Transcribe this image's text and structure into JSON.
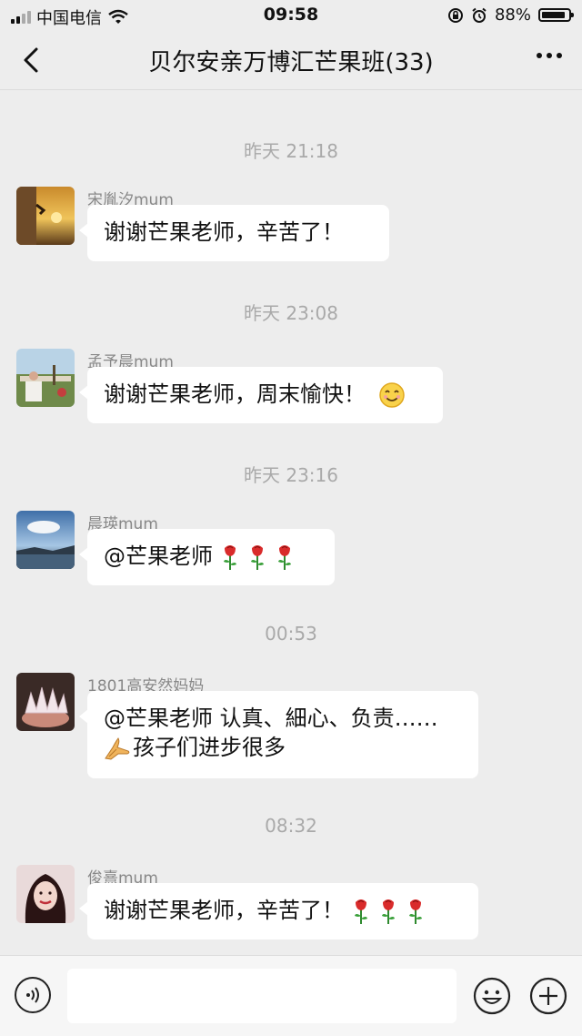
{
  "status_bar": {
    "carrier": "中国电信",
    "time": "09:58",
    "battery": "88%",
    "battery_level": 0.88
  },
  "header": {
    "back_icon": "chevron-left-icon",
    "title": "贝尔安亲万博汇芒果班(33)",
    "more_icon": "more-dots-icon"
  },
  "messages": [
    {
      "timestamp": "昨天 21:18",
      "sender": "宋胤汐mum",
      "text": "谢谢芒果老师，辛苦了！"
    },
    {
      "timestamp": "昨天 23:08",
      "sender": "孟予晨mum",
      "text": "谢谢芒果老师，周末愉快！",
      "emoji": "smile-emoji"
    },
    {
      "timestamp": "昨天 23:16",
      "sender": "晨瑛mum",
      "text": "@芒果老师",
      "emoji": "rose-emoji"
    },
    {
      "timestamp": "00:53",
      "sender": "1801高安然妈妈",
      "text_line1": "@芒果老师 认真、細心、负责……",
      "text_line2": "孩子们进步很多",
      "emoji": "praying-hands-emoji"
    },
    {
      "timestamp": "08:32",
      "sender": "俊熹mum",
      "text": "谢谢芒果老师，辛苦了！",
      "emoji": "rose-emoji"
    }
  ],
  "input_bar": {
    "voice_icon": "voice-icon",
    "input_value": "",
    "emoji_icon": "emoji-icon",
    "plus_icon": "plus-icon"
  }
}
